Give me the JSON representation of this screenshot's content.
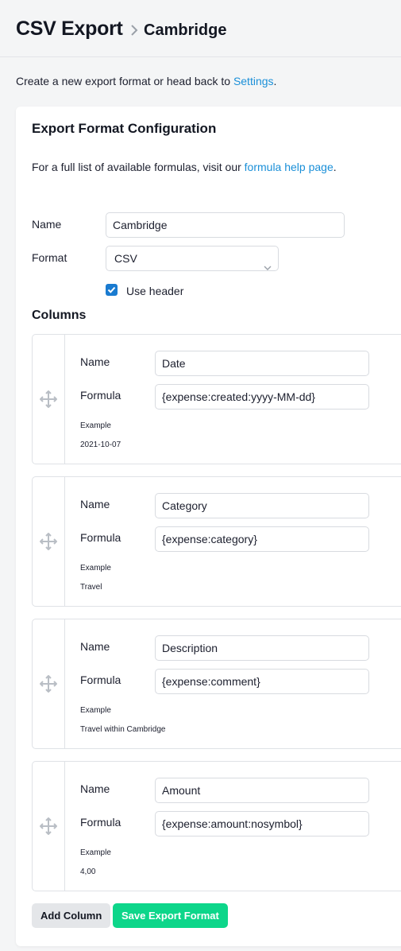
{
  "breadcrumb": {
    "root": "CSV Export",
    "current": "Cambridge"
  },
  "intro": {
    "text": "Create a new export format or head back to ",
    "link": "Settings",
    "suffix": "."
  },
  "form": {
    "title": "Export Format Configuration",
    "help_text": "For a full list of available formulas, visit our ",
    "help_link": "formula help page",
    "help_suffix": ".",
    "name_label": "Name",
    "name_value": "Cambridge",
    "format_label": "Format",
    "format_value": "CSV",
    "use_header_label": "Use header",
    "use_header_checked": true,
    "columns_title": "Columns"
  },
  "columns": [
    {
      "name_label": "Name",
      "formula_label": "Formula",
      "name": "Date",
      "formula": "{expense:created:yyyy-MM-dd}",
      "example_label": "Example",
      "example": "2021-10-07"
    },
    {
      "name_label": "Name",
      "formula_label": "Formula",
      "name": "Category",
      "formula": "{expense:category}",
      "example_label": "Example",
      "example": "Travel"
    },
    {
      "name_label": "Name",
      "formula_label": "Formula",
      "name": "Description",
      "formula": "{expense:comment}",
      "example_label": "Example",
      "example": "Travel within Cambridge"
    },
    {
      "name_label": "Name",
      "formula_label": "Formula",
      "name": "Amount",
      "formula": "{expense:amount:nosymbol}",
      "example_label": "Example",
      "example": "4,00"
    }
  ],
  "buttons": {
    "add_column": "Add Column",
    "save": "Save Export Format"
  },
  "colors": {
    "link": "#1a8fd8",
    "primary_button": "#0dd68a",
    "checkbox": "#1a7bd0"
  }
}
